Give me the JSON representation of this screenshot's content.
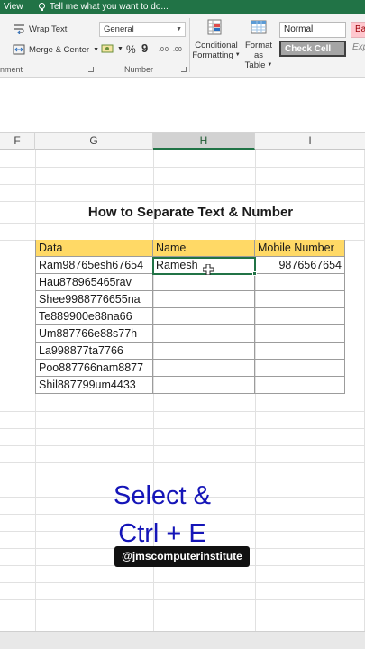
{
  "titlebar": {
    "view_tab": "View",
    "tell_me": "Tell me what you want to do..."
  },
  "ribbon": {
    "wrap_text": "Wrap Text",
    "merge_center": "Merge & Center",
    "number_format": "General",
    "percent": "%",
    "comma": "9",
    "group_alignment": "nment",
    "group_number": "Number",
    "conditional_formatting_line1": "Conditional",
    "conditional_formatting_line2": "Formatting",
    "format_as_table_line1": "Format as",
    "format_as_table_line2": "Table",
    "styles": {
      "normal": "Normal",
      "bad": "Bad",
      "check_cell": "Check Cell",
      "explanatory": "Exp"
    }
  },
  "columns": [
    "F",
    "G",
    "H",
    "I"
  ],
  "sheet": {
    "title": "How to Separate Text & Number",
    "headers": [
      "Data",
      "Name",
      "Mobile Number"
    ],
    "rows": [
      [
        "Ram98765esh67654",
        "Ramesh",
        "9876567654"
      ],
      [
        "Hau878965465rav",
        "",
        ""
      ],
      [
        "Shee9988776655na",
        "",
        ""
      ],
      [
        "Te889900e88na66",
        "",
        ""
      ],
      [
        "Um887766e88s77h",
        "",
        ""
      ],
      [
        "La998877ta7766",
        "",
        ""
      ],
      [
        "Poo887766nam8877",
        "",
        ""
      ],
      [
        "Shil887799um4433",
        "",
        ""
      ]
    ]
  },
  "overlay": {
    "line1": "Select &",
    "line2": "Ctrl + E",
    "watermark": "@jmscomputerinstitute"
  },
  "colors": {
    "excel_green": "#217346",
    "header_fill": "#ffd966",
    "overlay_text": "#1515b8"
  }
}
